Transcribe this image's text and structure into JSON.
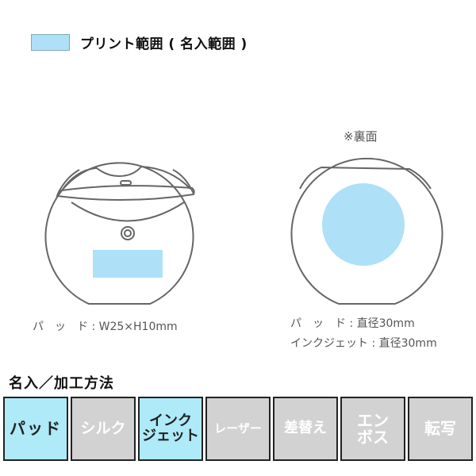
{
  "legend": {
    "label": "プリント範囲 ( 名入範囲 )",
    "swatch_color": "#aee0f8"
  },
  "front_view": {
    "caption": "パ　ッ　ド : W25×H10mm"
  },
  "back_view": {
    "note": "※裏面",
    "captions": [
      "パ　ッ　ド : 直径30mm",
      "インクジェット : 直径30mm"
    ]
  },
  "methods": {
    "title": "名入／加工方法",
    "items": [
      {
        "label": "パッド",
        "lines": [
          "パッド"
        ],
        "active": true
      },
      {
        "label": "シルク",
        "lines": [
          "シルク"
        ],
        "active": false
      },
      {
        "label": "インクジェット",
        "lines": [
          "インク",
          "ジェット"
        ],
        "active": true
      },
      {
        "label": "レーザー",
        "lines": [
          "レーザー"
        ],
        "active": false
      },
      {
        "label": "差替え",
        "lines": [
          "差替え"
        ],
        "active": false
      },
      {
        "label": "エンボス",
        "lines": [
          "エン",
          "ボス"
        ],
        "active": false
      },
      {
        "label": "転写",
        "lines": [
          "転写"
        ],
        "active": false
      }
    ],
    "active_color": "#aeeaf8",
    "inactive_color": "#d2d2d2"
  }
}
